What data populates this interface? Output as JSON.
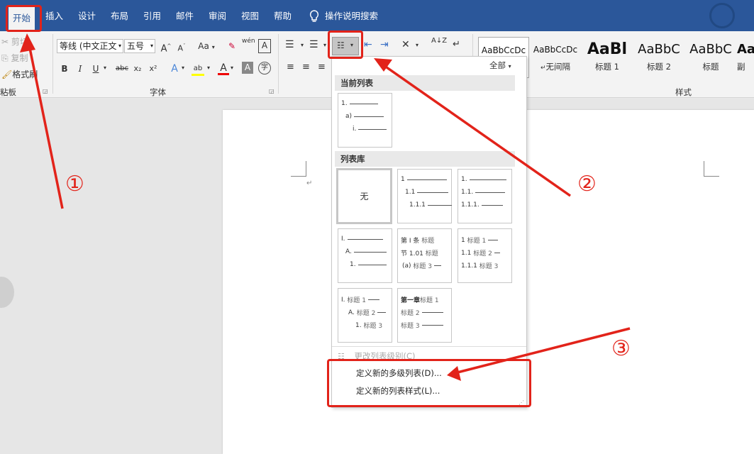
{
  "tabs": [
    "开始",
    "插入",
    "设计",
    "布局",
    "引用",
    "邮件",
    "审阅",
    "视图",
    "帮助"
  ],
  "help_search": "操作说明搜索",
  "clipboard": {
    "cut": "剪切",
    "copy": "复制",
    "format_painter": "格式刷",
    "group_label": "粘板"
  },
  "font": {
    "font_name": "等线 (中文正文",
    "font_size": "五号",
    "group_label": "字体",
    "grow": "A",
    "shrink": "A",
    "case": "Aa",
    "bold": "B",
    "italic": "I",
    "underline": "U",
    "strike": "abc",
    "subscript": "x₂",
    "superscript": "x²",
    "effects": "A",
    "highlight": "ab",
    "color": "A",
    "char_shade": "A",
    "phonetic": "wén",
    "border_char": "A",
    "enclose": "字"
  },
  "paragraph": {
    "sort": "A↓Z"
  },
  "styles": {
    "group_label": "样式",
    "items": [
      {
        "sample": "AaBbCcDc",
        "name": ""
      },
      {
        "sample": "AaBbCcDc",
        "name": "无间隔"
      },
      {
        "sample": "AaBl",
        "name": "标题 1"
      },
      {
        "sample": "AaBbC",
        "name": "标题 2"
      },
      {
        "sample": "AaBbC",
        "name": "标题"
      },
      {
        "sample": "Aa",
        "name": "副"
      }
    ]
  },
  "dropdown": {
    "filter": "全部",
    "current_list_header": "当前列表",
    "list_library_header": "列表库",
    "none_label": "无",
    "current_list": [
      "1.",
      "a)",
      "i."
    ],
    "library": [
      [
        "1",
        "1.1",
        "1.1.1"
      ],
      [
        "1.",
        "1.1.",
        "1.1.1."
      ],
      [
        "I.",
        "A.",
        "1."
      ],
      [
        "第 Ⅰ 条",
        "节 1.01",
        "(a)"
      ],
      [
        "1",
        "1.1",
        "1.1.1"
      ],
      [
        "I.",
        "A.",
        "1."
      ],
      [
        "第一章",
        "",
        ""
      ]
    ],
    "heading_suffixes": {
      "article": [
        "标题",
        "标题",
        "标题 3"
      ],
      "numbered": [
        "标题 1",
        "标题 2",
        "标题 3"
      ],
      "roman": [
        "标题 1",
        "标题 2",
        "标题 3"
      ],
      "chapter": [
        "标题 1",
        "标题 2",
        "标题 3"
      ]
    },
    "change_level": "更改列表级别(C)",
    "define_new_multilevel": "定义新的多级列表(D)...",
    "define_new_style": "定义新的列表样式(L)..."
  },
  "annotations": {
    "step1": "①",
    "step2": "②",
    "step3": "③"
  },
  "colors": {
    "accent": "#2b579a",
    "annotation": "#e2231a"
  }
}
